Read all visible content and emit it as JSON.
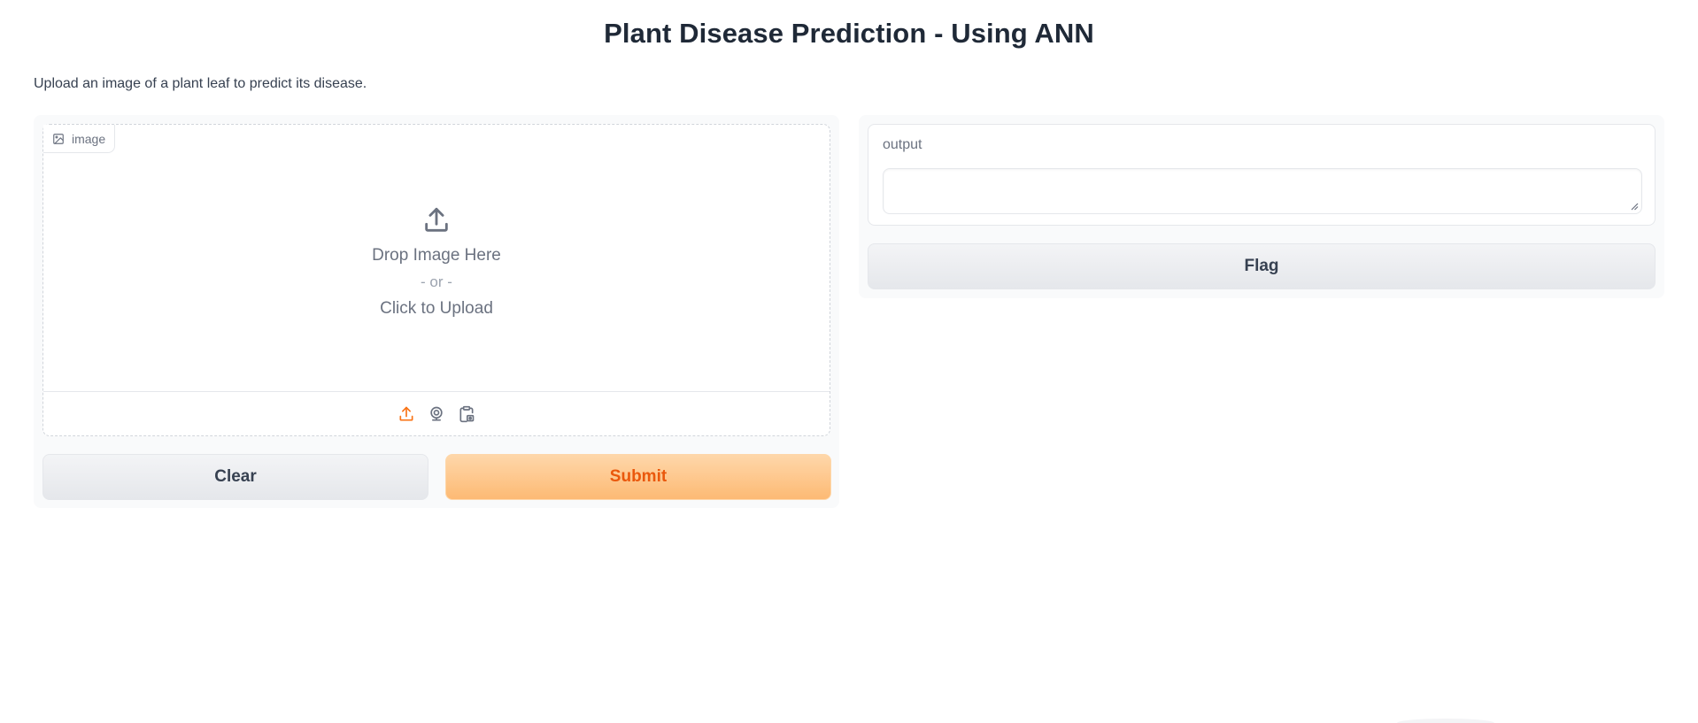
{
  "header": {
    "title": "Plant Disease Prediction - Using ANN",
    "description": "Upload an image of a plant leaf to predict its disease."
  },
  "input": {
    "label": "image",
    "drop_text": "Drop Image Here",
    "or_text": "- or -",
    "click_text": "Click to Upload",
    "sources": [
      "upload-icon",
      "webcam-icon",
      "clipboard-icon"
    ]
  },
  "buttons": {
    "clear": "Clear",
    "submit": "Submit",
    "flag": "Flag"
  },
  "output": {
    "label": "output",
    "value": ""
  },
  "colors": {
    "accent": "#ea580c",
    "submit_bg": "#fdba74",
    "neutral_btn": "#e5e7eb",
    "text": "#1f2937"
  }
}
